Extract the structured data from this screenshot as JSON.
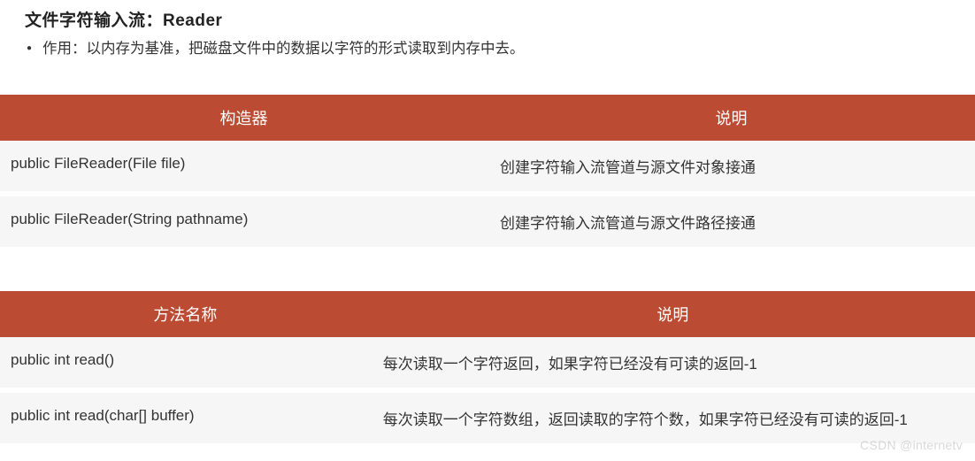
{
  "title": "文件字符输入流：Reader",
  "bullet": {
    "label": "作用：",
    "text": "以内存为基准，把磁盘文件中的数据以字符的形式读取到内存中去。"
  },
  "table1": {
    "headers": [
      "构造器",
      "说明"
    ],
    "rows": [
      {
        "c1": "public FileReader(File file)",
        "c2": "创建字符输入流管道与源文件对象接通"
      },
      {
        "c1": "public FileReader(String pathname)",
        "c2": "创建字符输入流管道与源文件路径接通"
      }
    ]
  },
  "table2": {
    "headers": [
      "方法名称",
      "说明"
    ],
    "rows": [
      {
        "c1": "public int read()",
        "c2": "每次读取一个字符返回，如果字符已经没有可读的返回-1"
      },
      {
        "c1": "public int read(char[] buffer)",
        "c2": "每次读取一个字符数组，返回读取的字符个数，如果字符已经没有可读的返回-1"
      }
    ]
  },
  "watermark": "CSDN @internetv"
}
